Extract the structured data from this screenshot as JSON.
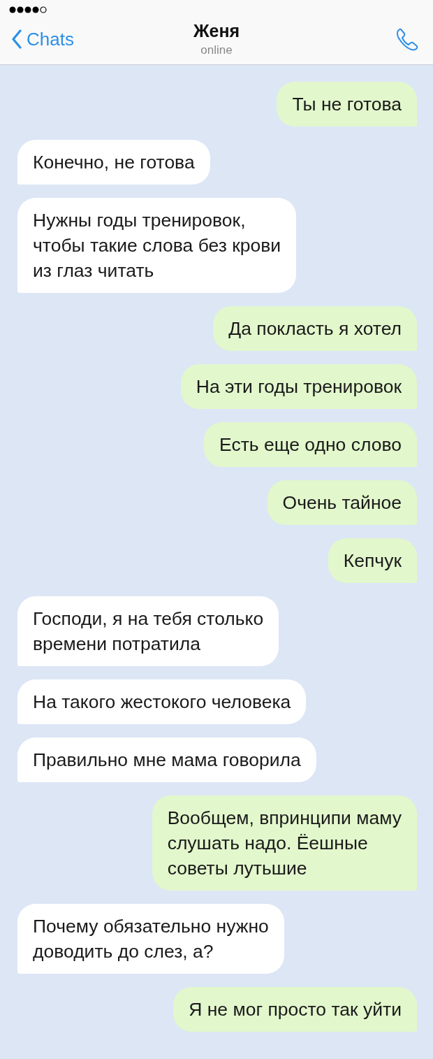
{
  "header": {
    "back_label": "Chats",
    "title": "Женя",
    "status": "online"
  },
  "messages": [
    {
      "kind": "outgoing",
      "text": "Ты не готова"
    },
    {
      "kind": "incoming",
      "text": "Конечно, не готова"
    },
    {
      "kind": "incoming",
      "text": "Нужны годы тренировок,\nчтобы такие слова без крови\nиз глаз читать"
    },
    {
      "kind": "outgoing",
      "text": "Да покласть я хотел"
    },
    {
      "kind": "outgoing",
      "text": "На эти годы тренировок"
    },
    {
      "kind": "outgoing",
      "text": "Есть еще одно слово"
    },
    {
      "kind": "outgoing",
      "text": "Очень тайное"
    },
    {
      "kind": "outgoing",
      "text": "Кепчук"
    },
    {
      "kind": "incoming",
      "text": "Господи, я на тебя столько\nвремени потратила"
    },
    {
      "kind": "incoming",
      "text": "На такого жестокого человека"
    },
    {
      "kind": "incoming",
      "text": "Правильно мне мама говорила"
    },
    {
      "kind": "outgoing",
      "text": "Вообщем, впринципи маму\nслушать надо. Ёешные\nсоветы лутьшие"
    },
    {
      "kind": "incoming",
      "text": "Почему обязательно нужно\nдоводить до слез, а?"
    },
    {
      "kind": "outgoing",
      "text": "Я не мог просто так уйти"
    }
  ]
}
